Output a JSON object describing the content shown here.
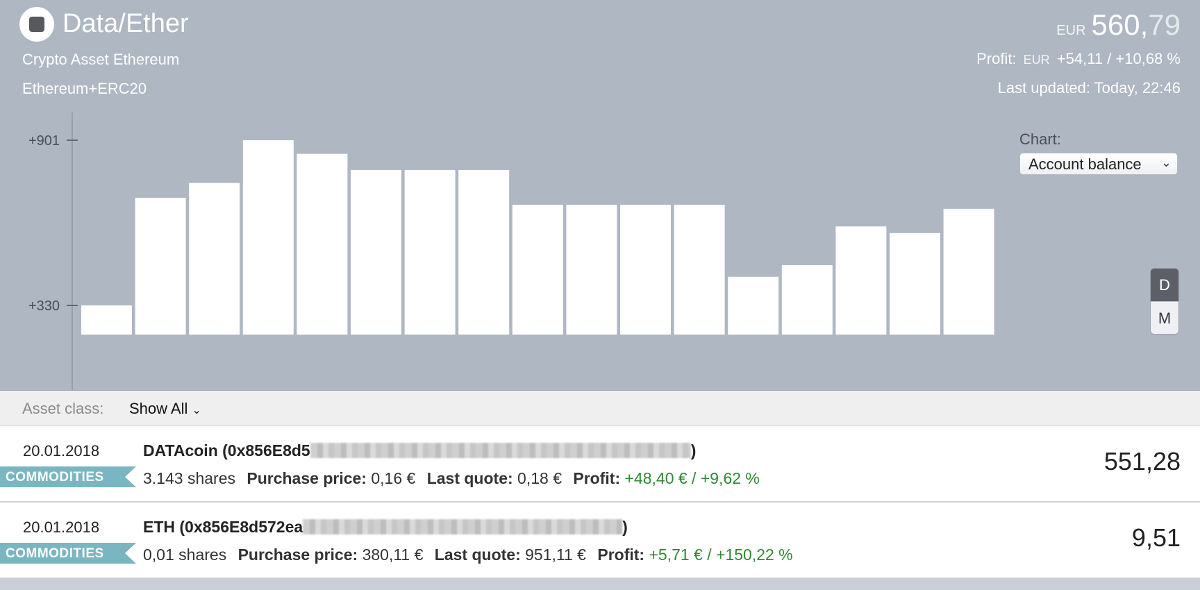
{
  "header": {
    "title": "Data/Ether",
    "subtitle1": "Crypto Asset Ethereum",
    "subtitle2": "Ethereum+ERC20",
    "balance_currency": "EUR",
    "balance_int": "560,",
    "balance_dec": "79",
    "profit_label": "Profit:",
    "profit_currency": "EUR",
    "profit_value": "+54,11 / +10,68 %",
    "updated": "Last updated: Today, 22:46"
  },
  "chart_controls": {
    "label": "Chart:",
    "selected": "Account balance",
    "range_buttons": [
      "D",
      "M"
    ],
    "active_range": "D"
  },
  "chart_data": {
    "type": "bar",
    "ticks": [
      "+901",
      "+330"
    ],
    "tick_values": [
      901,
      330
    ],
    "values": [
      330,
      702,
      753,
      901,
      854,
      798,
      798,
      798,
      678,
      678,
      678,
      678,
      429,
      469,
      603,
      580,
      664
    ],
    "colors": {
      "bar": "#ffffff",
      "axis": "#4a4f57"
    }
  },
  "filter": {
    "label": "Asset class:",
    "value": "Show All",
    "chevron": "chevron-down-icon"
  },
  "rows": [
    {
      "date": "20.01.2018",
      "name": "DATAcoin (0x856E8d5",
      "name_end": ")",
      "badge": "COMMODITIES",
      "shares": "3.143 shares",
      "purchase_label": "Purchase price:",
      "purchase_value": "0,16 €",
      "quote_label": "Last quote:",
      "quote_value": "0,18 €",
      "profit_label": "Profit:",
      "profit_value": "+48,40 € / +9,62 %",
      "amount": "551,28"
    },
    {
      "date": "20.01.2018",
      "name": "ETH (0x856E8d572ea",
      "name_end": ")",
      "badge": "COMMODITIES",
      "shares": "0,01 shares",
      "purchase_label": "Purchase price:",
      "purchase_value": "380,11 €",
      "quote_label": "Last quote:",
      "quote_value": "951,11 €",
      "profit_label": "Profit:",
      "profit_value": "+5,71 € / +150,22 %",
      "amount": "9,51"
    }
  ]
}
